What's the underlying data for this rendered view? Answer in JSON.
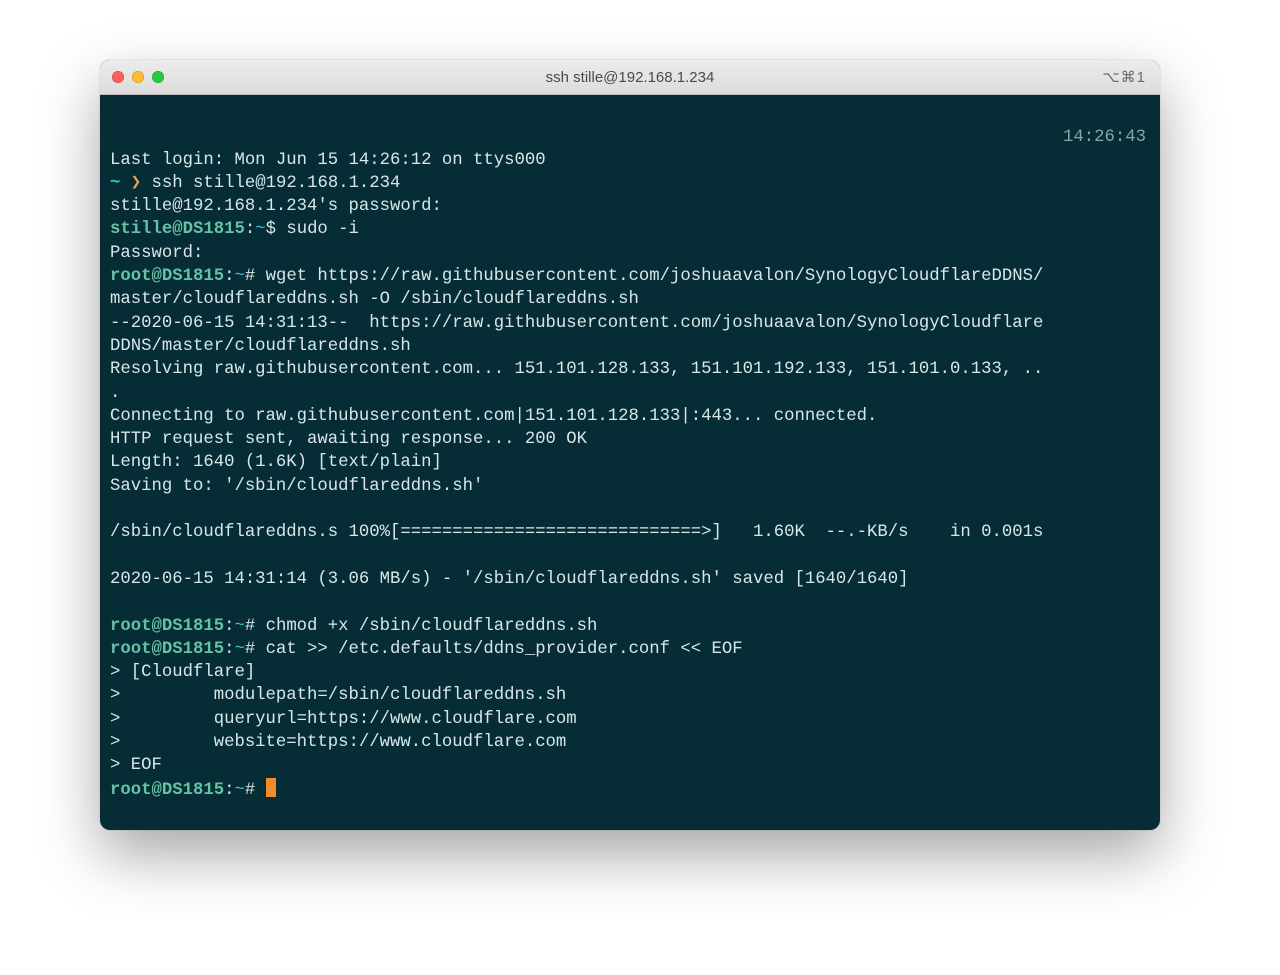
{
  "window": {
    "title": "ssh stille@192.168.1.234",
    "shortcut": "⌥⌘1"
  },
  "timestamp": "14:26:43",
  "lines": {
    "l0": "Last login: Mon Jun 15 14:26:12 on ttys000",
    "p0_tilde": "~ ",
    "p0_arrow": "❯",
    "p0_cmd": " ssh stille@192.168.1.234",
    "l2": "stille@192.168.1.234's password:",
    "p1_userhost": "stille@DS1815",
    "p1_colon": ":",
    "p1_path": "~",
    "p1_dollar": "$",
    "p1_cmd": " sudo -i",
    "l4": "Password:",
    "p2_userhost": "root@DS1815",
    "p2_colon": ":",
    "p2_path": "~",
    "p2_hash": "#",
    "p2_cmd": " wget https://raw.githubusercontent.com/joshuaavalon/SynologyCloudflareDDNS/",
    "l6": "master/cloudflareddns.sh -O /sbin/cloudflareddns.sh",
    "l7": "--2020-06-15 14:31:13--  https://raw.githubusercontent.com/joshuaavalon/SynologyCloudflare",
    "l8": "DDNS/master/cloudflareddns.sh",
    "l9": "Resolving raw.githubusercontent.com... 151.101.128.133, 151.101.192.133, 151.101.0.133, ..",
    "l10": ".",
    "l11": "Connecting to raw.githubusercontent.com|151.101.128.133|:443... connected.",
    "l12": "HTTP request sent, awaiting response... 200 OK",
    "l13": "Length: 1640 (1.6K) [text/plain]",
    "l14": "Saving to: '/sbin/cloudflareddns.sh'",
    "blank1": " ",
    "l15": "/sbin/cloudflareddns.s 100%[=============================>]   1.60K  --.-KB/s    in 0.001s",
    "blank2": " ",
    "l16": "2020-06-15 14:31:14 (3.06 MB/s) - '/sbin/cloudflareddns.sh' saved [1640/1640]",
    "blank3": " ",
    "p3_userhost": "root@DS1815",
    "p3_cmd": " chmod +x /sbin/cloudflareddns.sh",
    "p4_userhost": "root@DS1815",
    "p4_cmd": " cat >> /etc.defaults/ddns_provider.conf << EOF",
    "h1": "> [Cloudflare]",
    "h2": ">         modulepath=/sbin/cloudflareddns.sh",
    "h3": ">         queryurl=https://www.cloudflare.com",
    "h4": ">         website=https://www.cloudflare.com",
    "h5": "> EOF",
    "p5_userhost": "root@DS1815"
  }
}
